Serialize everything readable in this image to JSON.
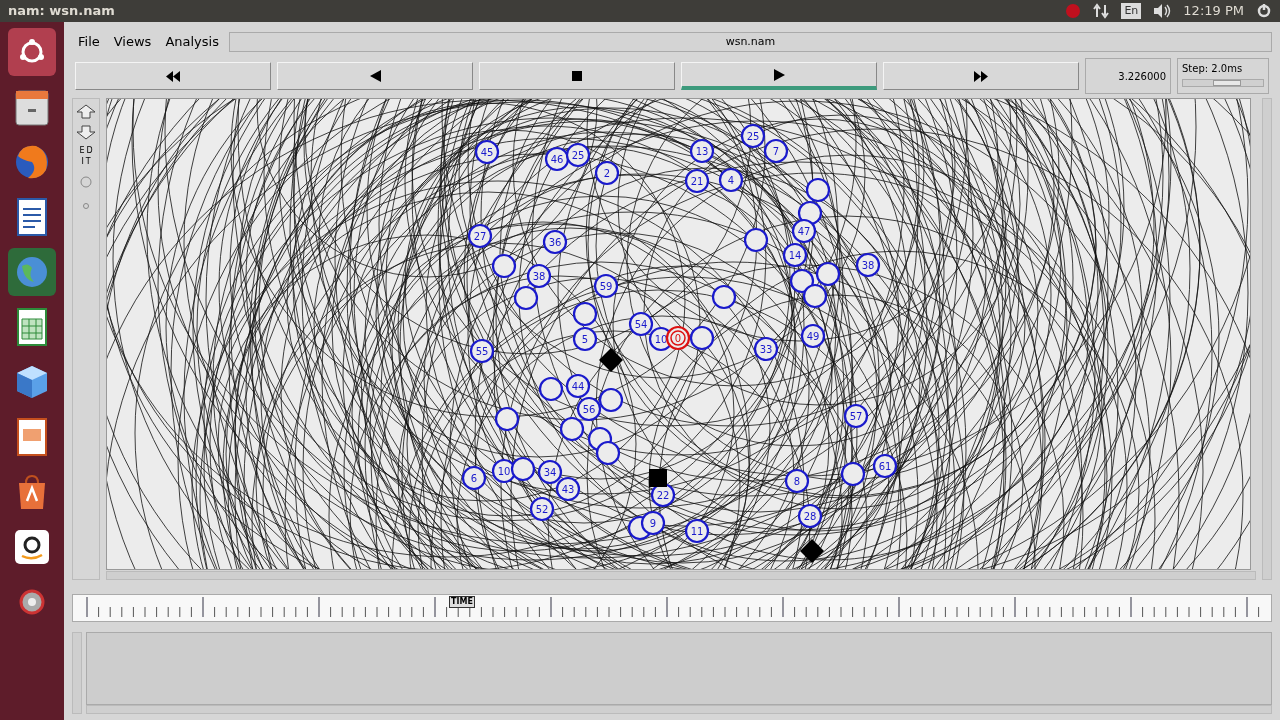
{
  "top_bar": {
    "title": "nam: wsn.nam",
    "keyboard": "En",
    "clock": "12:19 PM"
  },
  "menu": [
    "File",
    "Views",
    "Analysis"
  ],
  "file_name": "wsn.nam",
  "transport": [
    {
      "kind": "rewind",
      "selected": false
    },
    {
      "kind": "back",
      "selected": false
    },
    {
      "kind": "stop",
      "selected": false
    },
    {
      "kind": "play",
      "selected": true
    },
    {
      "kind": "forward",
      "selected": false
    }
  ],
  "time": "3.226000",
  "step": {
    "label": "Step: 2.0ms",
    "level": 0.55
  },
  "edit_tool": "EDIT",
  "nodes": [
    {
      "label": "45",
      "highlighted": false
    },
    {
      "label": "46",
      "highlighted": false
    },
    {
      "label": "25",
      "highlighted": false
    },
    {
      "label": "2",
      "highlighted": false
    },
    {
      "label": "13",
      "highlighted": false
    },
    {
      "label": "25",
      "highlighted": false
    },
    {
      "label": "7",
      "highlighted": false
    },
    {
      "label": "21",
      "highlighted": false
    },
    {
      "label": "4",
      "highlighted": false
    },
    {
      "highlighted": false
    },
    {
      "highlighted": false
    },
    {
      "label": "47",
      "highlighted": false
    },
    {
      "label": "27",
      "highlighted": false
    },
    {
      "label": "36",
      "highlighted": false
    },
    {
      "highlighted": false
    },
    {
      "label": "38",
      "highlighted": false
    },
    {
      "label": "59",
      "highlighted": false
    },
    {
      "highlighted": false
    },
    {
      "highlighted": false
    },
    {
      "label": "14",
      "highlighted": false
    },
    {
      "label": "38",
      "highlighted": false
    },
    {
      "highlighted": false
    },
    {
      "highlighted": false
    },
    {
      "highlighted": false
    },
    {
      "highlighted": false
    },
    {
      "highlighted": false
    },
    {
      "label": "5",
      "highlighted": false
    },
    {
      "label": "54",
      "highlighted": false
    },
    {
      "label": "10",
      "highlighted": false
    },
    {
      "label": "0",
      "highlighted": true
    },
    {
      "highlighted": false
    },
    {
      "label": "33",
      "highlighted": false
    },
    {
      "label": "49",
      "highlighted": false
    },
    {
      "label": "55",
      "highlighted": false
    },
    {
      "highlighted": false
    },
    {
      "label": "44",
      "highlighted": false
    },
    {
      "label": "56",
      "highlighted": false
    },
    {
      "highlighted": false
    },
    {
      "highlighted": false
    },
    {
      "highlighted": false
    },
    {
      "highlighted": false
    },
    {
      "highlighted": false
    },
    {
      "label": "57",
      "highlighted": false
    },
    {
      "label": "6",
      "highlighted": false
    },
    {
      "label": "10",
      "highlighted": false
    },
    {
      "highlighted": false
    },
    {
      "label": "34",
      "highlighted": false
    },
    {
      "label": "43",
      "highlighted": false
    },
    {
      "label": "52",
      "highlighted": false
    },
    {
      "label": "22",
      "highlighted": false
    },
    {
      "label": "8",
      "highlighted": false
    },
    {
      "highlighted": false
    },
    {
      "label": "61",
      "highlighted": false
    },
    {
      "highlighted": false
    },
    {
      "label": "9",
      "highlighted": false
    },
    {
      "label": "11",
      "highlighted": false
    },
    {
      "label": "28",
      "highlighted": false
    }
  ],
  "timeline_marker": "TIME"
}
